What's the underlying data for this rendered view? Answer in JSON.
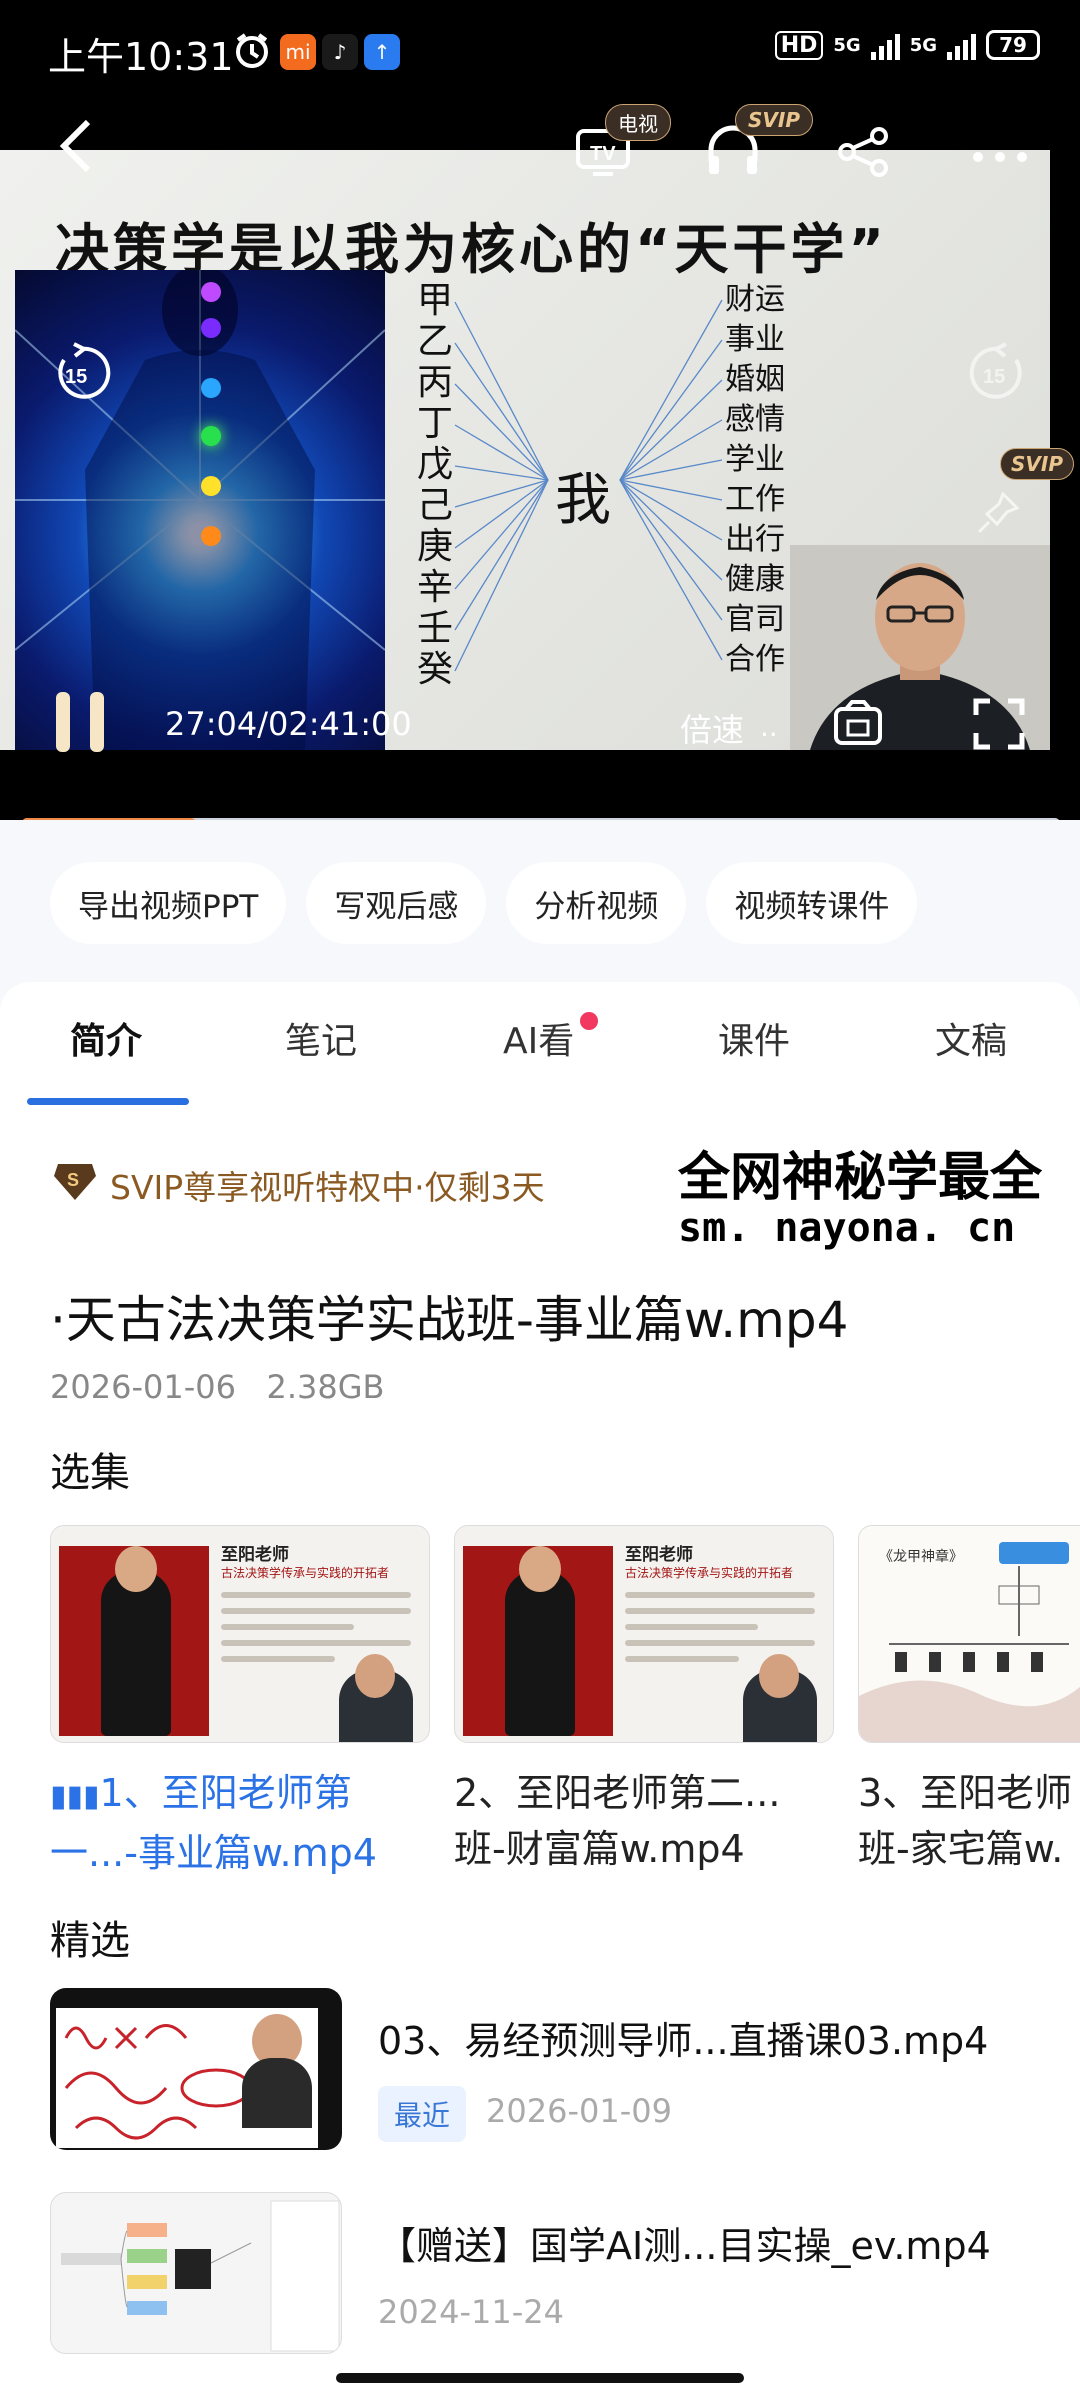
{
  "status_bar": {
    "time": "上午10:31",
    "network_1": "5G",
    "network_2": "5G",
    "hd": "HD",
    "battery": "79"
  },
  "player": {
    "tv_badge": "电视",
    "svip_badge": "SVIP",
    "svip_badge_side": "SVIP",
    "slide_title": "决策学是以我为核心的“天干学”",
    "heavenly_stems": [
      "甲",
      "乙",
      "丙",
      "丁",
      "戊",
      "己",
      "庚",
      "辛",
      "壬",
      "癸"
    ],
    "center_label": "我",
    "aspects": [
      "财运",
      "事业",
      "婚姻",
      "感情",
      "学业",
      "工作",
      "出行",
      "健康",
      "官司",
      "合作"
    ],
    "skip_back": "15",
    "skip_forward": "15",
    "time_display": "27:04/02:41:00",
    "speed_label": "倍速",
    "progress": 0.168
  },
  "actions": [
    "导出视频PPT",
    "写观后感",
    "分析视频",
    "视频转课件"
  ],
  "tabs": [
    "简介",
    "笔记",
    "AI看",
    "课件",
    "文稿"
  ],
  "svip_notice": "SVIP尊享视听特权中·仅剩3天",
  "watermark": {
    "text": "全网神秘学最全",
    "url": "sm. nayona. cn"
  },
  "video": {
    "title": "·天古法决策学实战班-事业篇w.mp4",
    "date": "2026-01-06",
    "size": "2.38GB"
  },
  "episodes_heading": "选集",
  "episodes": [
    {
      "line1": "1、至阳老师第",
      "line2": "一...-事业篇w.mp4",
      "active": true
    },
    {
      "line1": "2、至阳老师第二...",
      "line2": "班-财富篇w.mp4",
      "active": false
    },
    {
      "line1": "3、至阳老师",
      "line2": "班-家宅篇w.",
      "active": false
    }
  ],
  "episode_thumb": {
    "teacher_name": "至阳老师",
    "subtitle": "古法决策学传承与实践的开拓者",
    "third_title": "《龙甲神章》"
  },
  "featured_heading": "精选",
  "featured": [
    {
      "title": "03、易经预测导师...直播课03.mp4",
      "tag": "最近",
      "date": "2026-01-09"
    },
    {
      "title": "【赠送】国学AI测...目实操_ev.mp4",
      "date": "2024-11-24"
    }
  ],
  "colors": {
    "accent": "#2a6fe0",
    "progress": "#f08a46",
    "svip_gold": "#8a5a22",
    "notification_dot": "#f2385f"
  }
}
